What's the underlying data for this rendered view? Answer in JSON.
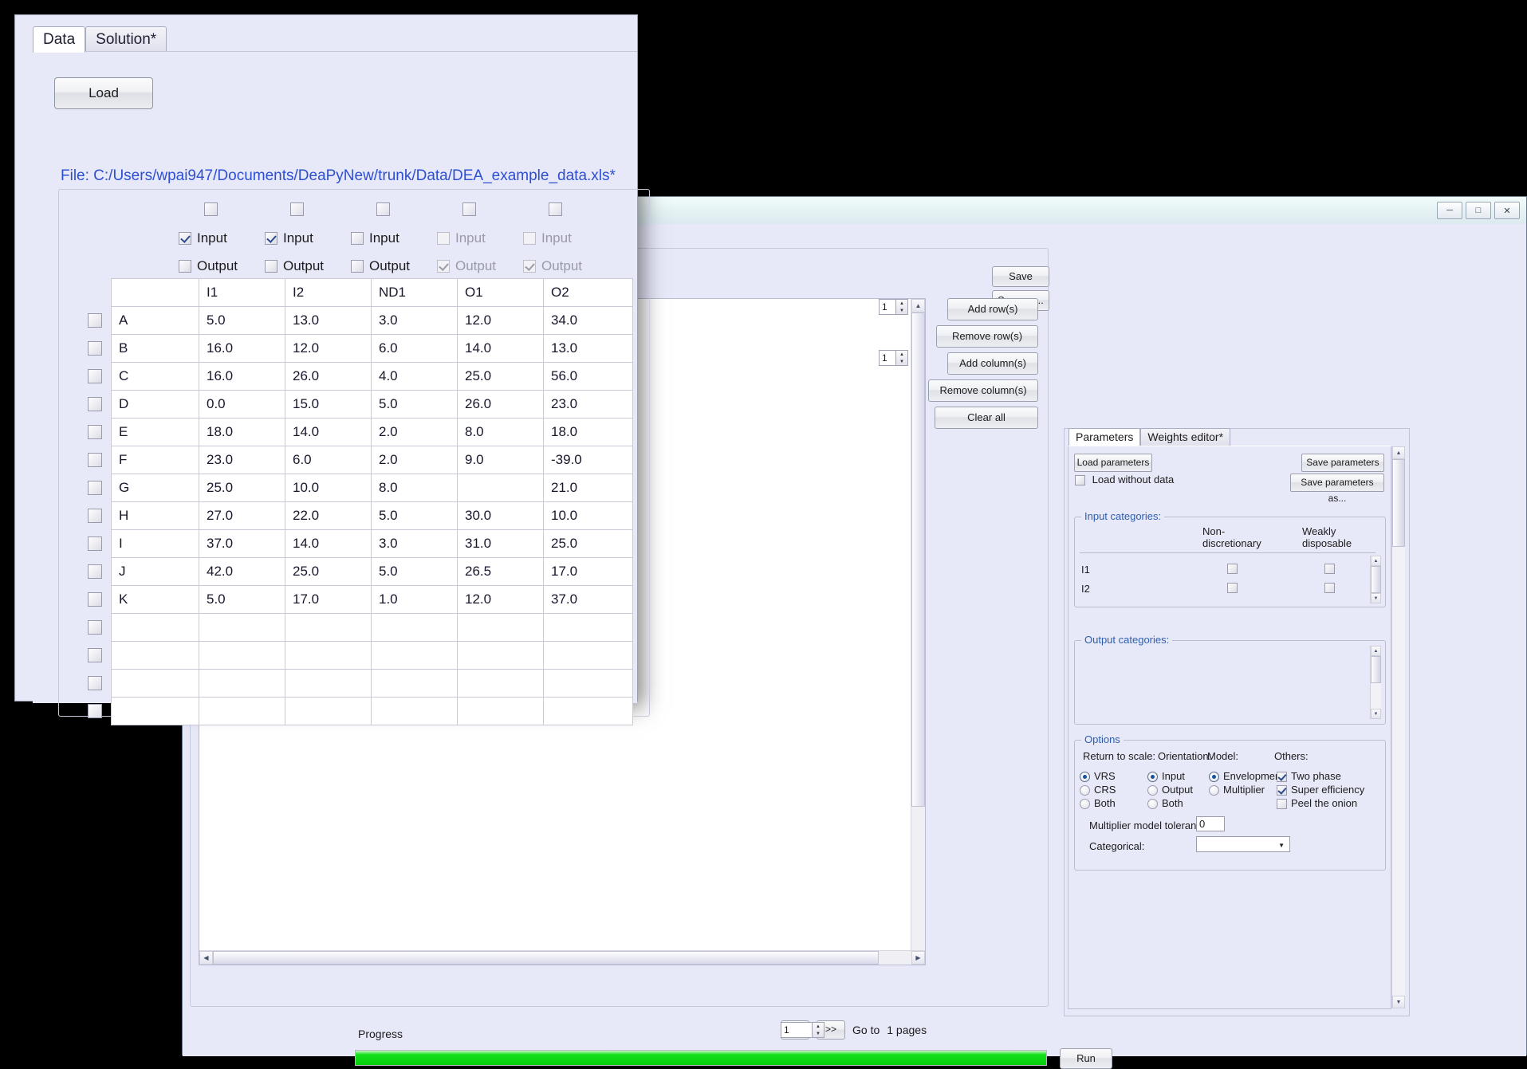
{
  "back_window": {
    "title_buttons": [
      "minimize",
      "maximize",
      "close"
    ],
    "save_buttons": [
      {
        "name": "save",
        "label": "Save"
      },
      {
        "name": "save-as",
        "label": "Save as..."
      }
    ],
    "row_col_controls": [
      {
        "name": "add-rows",
        "label": "Add row(s)",
        "spinner": "1"
      },
      {
        "name": "remove-rows",
        "label": "Remove row(s)"
      },
      {
        "name": "add-columns",
        "label": "Add column(s)",
        "spinner": "1"
      },
      {
        "name": "remove-columns",
        "label": "Remove column(s)"
      },
      {
        "name": "clear-all",
        "label": "Clear all"
      }
    ],
    "pager": {
      "prev_label": "<<",
      "next_label": ">>",
      "goto_label": "Go to",
      "page_value": "1",
      "pages_label": "1 pages"
    },
    "progress": {
      "label": "Progress",
      "percent": 100,
      "fill_color": "#05cf0b"
    },
    "run_label": "Run"
  },
  "right_panel": {
    "tabs": [
      {
        "label": "Parameters",
        "active": true
      },
      {
        "label": "Weights editor*",
        "active": false
      }
    ],
    "load_parameters_label": "Load parameters",
    "save_parameters_label": "Save parameters",
    "save_parameters_as_label": "Save parameters as...",
    "load_without_data": {
      "label": "Load without data",
      "checked": false
    },
    "input_categories": {
      "legend": "Input categories:",
      "columns": [
        "Non-\ndiscretionary",
        "Weakly\ndisposable"
      ],
      "col1": "Non-",
      "col1b": "discretionary",
      "col2": "Weakly",
      "col2b": "disposable",
      "rows": [
        {
          "name": "I1",
          "non_discretionary": false,
          "weakly_disposable": false
        },
        {
          "name": "I2",
          "non_discretionary": false,
          "weakly_disposable": false
        }
      ]
    },
    "output_categories": {
      "legend": "Output categories:",
      "rows": []
    },
    "options": {
      "legend": "Options",
      "groups": [
        {
          "title": "Return to scale:",
          "name": "return-to-scale",
          "options": [
            {
              "label": "VRS",
              "selected": true
            },
            {
              "label": "CRS",
              "selected": false
            },
            {
              "label": "Both",
              "selected": false
            }
          ]
        },
        {
          "title": "Orientation:",
          "name": "orientation",
          "options": [
            {
              "label": "Input",
              "selected": true
            },
            {
              "label": "Output",
              "selected": false
            },
            {
              "label": "Both",
              "selected": false
            }
          ]
        },
        {
          "title": "Model:",
          "name": "model",
          "options": [
            {
              "label": "Envelopment",
              "selected": true
            },
            {
              "label": "Multiplier",
              "selected": false
            }
          ]
        }
      ],
      "others": {
        "title": "Others:",
        "checkboxes": [
          {
            "label": "Two phase",
            "checked": true
          },
          {
            "label": "Super efficiency",
            "checked": true
          },
          {
            "label": "Peel the onion",
            "checked": false
          }
        ]
      },
      "tolerance": {
        "label": "Multiplier model tolerance:",
        "value": "0"
      },
      "categorical": {
        "label": "Categorical:",
        "value": ""
      }
    }
  },
  "front_window": {
    "tabs": [
      {
        "label": "Data",
        "active": true
      },
      {
        "label": "Solution*",
        "active": false
      }
    ],
    "load_label": "Load",
    "file_label": "File: C:/Users/wpai947/Documents/DeaPyNew/trunk/Data/DEA_example_data.xls*",
    "columns": [
      {
        "name": "I1",
        "top_checked": false,
        "input": {
          "checked": true,
          "disabled": false
        },
        "output": {
          "checked": false,
          "disabled": false
        }
      },
      {
        "name": "I2",
        "top_checked": false,
        "input": {
          "checked": true,
          "disabled": false
        },
        "output": {
          "checked": false,
          "disabled": false
        }
      },
      {
        "name": "ND1",
        "top_checked": false,
        "input": {
          "checked": false,
          "disabled": false
        },
        "output": {
          "checked": false,
          "disabled": false
        }
      },
      {
        "name": "O1",
        "top_checked": false,
        "input": {
          "checked": false,
          "disabled": true
        },
        "output": {
          "checked": true,
          "disabled": true
        }
      },
      {
        "name": "O2",
        "top_checked": false,
        "input": {
          "checked": false,
          "disabled": true
        },
        "output": {
          "checked": true,
          "disabled": true
        }
      }
    ],
    "header_row": [
      "",
      "I1",
      "I2",
      "ND1",
      "O1",
      "O2"
    ],
    "input_label": "Input",
    "output_label": "Output",
    "rows": [
      {
        "name": "A",
        "cells": [
          {
            "v": "5.0"
          },
          {
            "v": "13.0"
          },
          {
            "v": "3.0"
          },
          {
            "v": "12.0"
          },
          {
            "v": "34.0"
          }
        ]
      },
      {
        "name": "B",
        "cells": [
          {
            "v": "16.0"
          },
          {
            "v": "12.0"
          },
          {
            "v": "6.0"
          },
          {
            "v": "14.0"
          },
          {
            "v": "13.0"
          }
        ]
      },
      {
        "name": "C",
        "cells": [
          {
            "v": "16.0"
          },
          {
            "v": "26.0"
          },
          {
            "v": "4.0"
          },
          {
            "v": "25.0"
          },
          {
            "v": "56.0"
          }
        ]
      },
      {
        "name": "D",
        "cells": [
          {
            "v": "0.0",
            "color": "orange"
          },
          {
            "v": "15.0"
          },
          {
            "v": "5.0"
          },
          {
            "v": "26.0"
          },
          {
            "v": "23.0"
          }
        ]
      },
      {
        "name": "E",
        "cells": [
          {
            "v": "18.0"
          },
          {
            "v": "14.0"
          },
          {
            "v": "2.0"
          },
          {
            "v": "8.0"
          },
          {
            "v": "18.0"
          }
        ]
      },
      {
        "name": "F",
        "cells": [
          {
            "v": "23.0"
          },
          {
            "v": "6.0"
          },
          {
            "v": "2.0"
          },
          {
            "v": "9.0"
          },
          {
            "v": "-39.0",
            "color": "red"
          }
        ]
      },
      {
        "name": "G",
        "cells": [
          {
            "v": "25.0"
          },
          {
            "v": "10.0"
          },
          {
            "v": "8.0"
          },
          {
            "v": ""
          },
          {
            "v": "21.0"
          }
        ]
      },
      {
        "name": "H",
        "cells": [
          {
            "v": "27.0"
          },
          {
            "v": "22.0"
          },
          {
            "v": "5.0"
          },
          {
            "v": "30.0"
          },
          {
            "v": "10.0"
          }
        ]
      },
      {
        "name": "I",
        "cells": [
          {
            "v": "37.0"
          },
          {
            "v": "14.0"
          },
          {
            "v": "3.0"
          },
          {
            "v": "31.0"
          },
          {
            "v": "25.0"
          }
        ]
      },
      {
        "name": "J",
        "cells": [
          {
            "v": "42.0"
          },
          {
            "v": "25.0"
          },
          {
            "v": "5.0"
          },
          {
            "v": "26.5"
          },
          {
            "v": "17.0"
          }
        ]
      },
      {
        "name": "K",
        "cells": [
          {
            "v": "5.0"
          },
          {
            "v": "17.0"
          },
          {
            "v": "1.0"
          },
          {
            "v": "12.0"
          },
          {
            "v": "37.0"
          }
        ]
      },
      {
        "name": "",
        "cells": [
          {
            "v": ""
          },
          {
            "v": ""
          },
          {
            "v": ""
          },
          {
            "v": ""
          },
          {
            "v": ""
          }
        ]
      },
      {
        "name": "",
        "cells": [
          {
            "v": ""
          },
          {
            "v": ""
          },
          {
            "v": ""
          },
          {
            "v": ""
          },
          {
            "v": ""
          }
        ]
      },
      {
        "name": "",
        "cells": [
          {
            "v": ""
          },
          {
            "v": ""
          },
          {
            "v": ""
          },
          {
            "v": ""
          },
          {
            "v": ""
          }
        ]
      },
      {
        "name": "",
        "cells": [
          {
            "v": ""
          },
          {
            "v": ""
          },
          {
            "v": ""
          },
          {
            "v": ""
          },
          {
            "v": ""
          }
        ]
      }
    ]
  },
  "colors": {
    "panel_bg": "#e7e8f8",
    "link_blue": "#2e4fd0",
    "legend_blue": "#2e5fae",
    "orange": "#f0a010",
    "red": "#ff1a1a",
    "green": "#05cf0b"
  }
}
